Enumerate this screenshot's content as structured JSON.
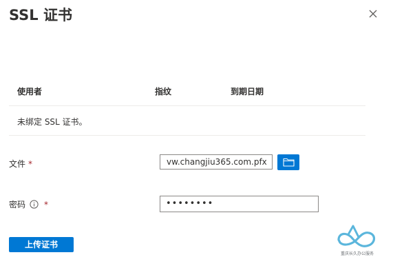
{
  "panel": {
    "title": "SSL 证书"
  },
  "table": {
    "headers": [
      "使用者",
      "指纹",
      "到期日期"
    ],
    "empty_message": "未绑定 SSL 证书。"
  },
  "form": {
    "file": {
      "label": "文件",
      "required_mark": "*",
      "value": "vw.changjiu365.com.pfx"
    },
    "password": {
      "label": "密码",
      "required_mark": "*",
      "value": "••••••••"
    }
  },
  "actions": {
    "upload_label": "上传证书"
  },
  "watermark": {
    "text": "重庆长久办公服务"
  },
  "colors": {
    "accent": "#0078d4",
    "required": "#a4262c",
    "watermark": "#5bb6dc"
  },
  "icons": [
    "close-icon",
    "folder-icon",
    "info-icon"
  ]
}
